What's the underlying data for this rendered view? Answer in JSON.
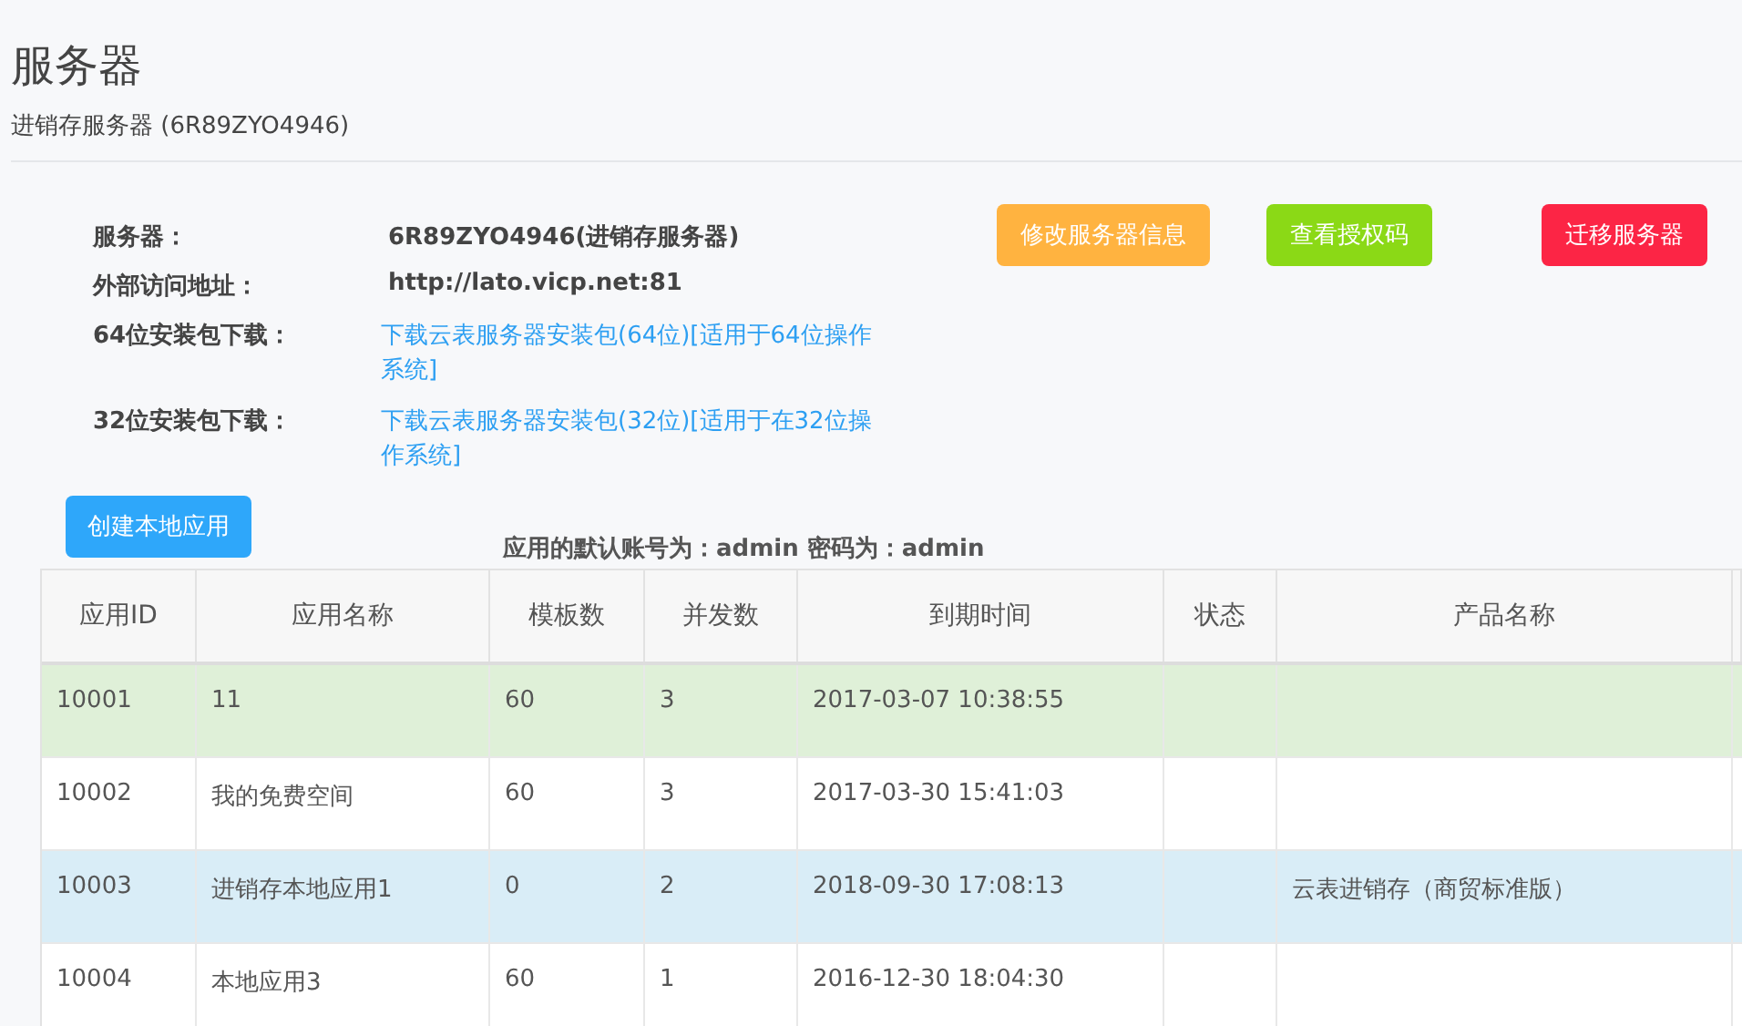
{
  "page": {
    "title": "服务器",
    "subtitle": "进销存服务器 (6R89ZYO4946)"
  },
  "info": [
    {
      "kind": "text",
      "label": "服务器：",
      "value": "6R89ZYO4946(进销存服务器)"
    },
    {
      "kind": "text",
      "label": "外部访问地址：",
      "value": "http://lato.vicp.net:81"
    },
    {
      "kind": "link",
      "label": "64位安装包下载：",
      "value": "下载云表服务器安装包(64位)[适用于64位操作系统]"
    },
    {
      "kind": "link",
      "label": "32位安装包下载：",
      "value": "下载云表服务器安装包(32位)[适用于在32位操作系统]"
    }
  ],
  "actions": [
    {
      "label": "修改服务器信息",
      "color": "#ffb340"
    },
    {
      "label": "查看授权码",
      "color": "#8bd916"
    },
    {
      "label": "迁移服务器",
      "color": "#fc2545"
    }
  ],
  "create_button": "创建本地应用",
  "default_account_note": "应用的默认账号为：admin 密码为：admin",
  "table": {
    "columns": [
      "应用ID",
      "应用名称",
      "模板数",
      "并发数",
      "到期时间",
      "状态",
      "产品名称"
    ],
    "rows": [
      {
        "color": "#dff0d8",
        "cells": [
          "10001",
          "11",
          "60",
          "3",
          "2017-03-07 10:38:55",
          "",
          ""
        ]
      },
      {
        "color": "#ffffff",
        "cells": [
          "10002",
          "我的免费空间",
          "60",
          "3",
          "2017-03-30 15:41:03",
          "",
          ""
        ]
      },
      {
        "color": "#d9edf7",
        "cells": [
          "10003",
          "进销存本地应用1",
          "0",
          "2",
          "2018-09-30 17:08:13",
          "",
          "云表进销存（商贸标准版）"
        ]
      },
      {
        "color": "#ffffff",
        "cells": [
          "10004",
          "本地应用3",
          "60",
          "1",
          "2016-12-30 18:04:30",
          "",
          ""
        ]
      }
    ]
  }
}
